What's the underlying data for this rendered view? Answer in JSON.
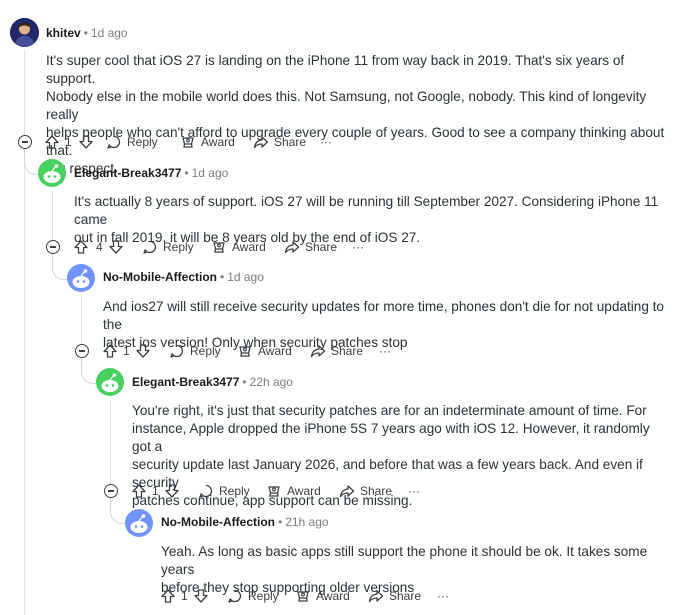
{
  "comments": [
    {
      "author": "khitev",
      "time": "1d ago",
      "lines": [
        "It's super cool that iOS 27 is landing on the iPhone 11 from way back in 2019. That's six years of support.",
        "Nobody else in the mobile world does this. Not Samsung, not Google, nobody. This kind of longevity really",
        "helps people who can't afford to upgrade every couple of years. Good to see a company thinking about that.",
        "Big respect."
      ],
      "votes": "1"
    },
    {
      "author": "Elegant-Break3477",
      "time": "1d ago",
      "lines": [
        "It's actually 8 years of support. iOS 27 will be running till September 2027. Considering iPhone 11 came",
        "out in fall 2019, it will be 8 years old by the end of iOS 27."
      ],
      "votes": "4"
    },
    {
      "author": "No-Mobile-Affection",
      "time": "1d ago",
      "lines": [
        "And ios27 will still receive security updates for more time,  phones don't die for not updating to the",
        "latest ios version! Only when security patches stop"
      ],
      "votes": "1"
    },
    {
      "author": "Elegant-Break3477",
      "time": "22h ago",
      "lines": [
        "You're right, it's just that security patches are for an indeterminate amount of time. For",
        "instance, Apple dropped the iPhone 5S 7 years ago with iOS 12. However, it randomly got a",
        "security update last January 2026, and before that was a few years back. And even if security",
        "patches continue, app support can be missing."
      ],
      "votes": "1"
    },
    {
      "author": "No-Mobile-Affection",
      "time": "21h ago",
      "lines": [
        "Yeah. As long as basic apps still support the phone it should be ok. It takes some years",
        "before they stop supporting older versions"
      ],
      "votes": "1"
    }
  ],
  "labels": {
    "separator": "•",
    "reply": "Reply",
    "award": "Award",
    "share": "Share",
    "more": "···"
  },
  "colors": {
    "green_avatar": "#46d160",
    "blue_avatar": "#7193ff",
    "thread_line": "#e1e3e6"
  },
  "icons": [
    "upvote-icon",
    "downvote-icon",
    "reply-icon",
    "award-icon",
    "share-icon",
    "more-icon",
    "collapse-icon"
  ]
}
